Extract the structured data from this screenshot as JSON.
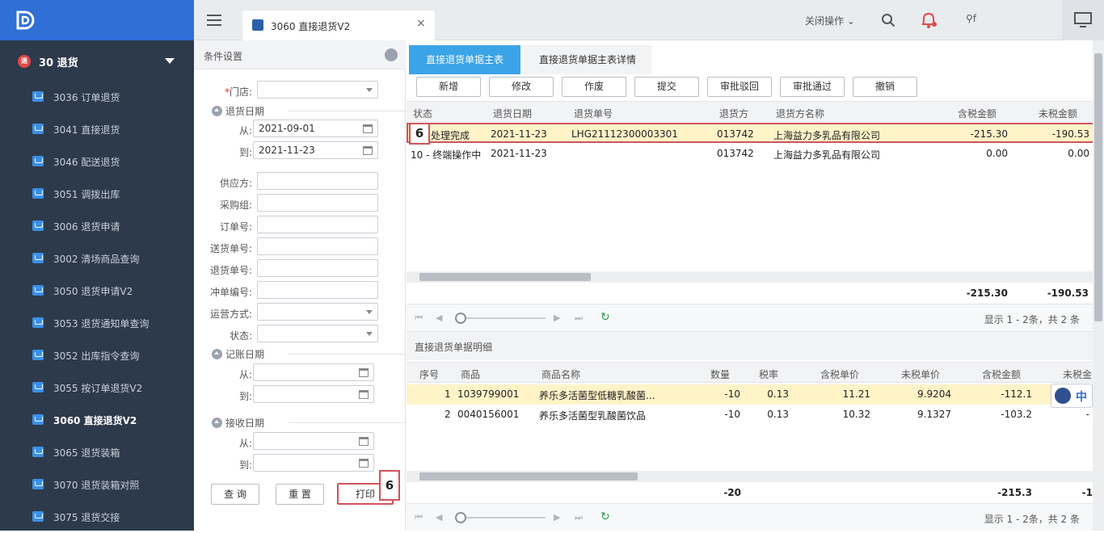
{
  "sidebar": {
    "group_badge": "退",
    "group_label": "30 退货",
    "items": [
      {
        "label": "3036 订单退货"
      },
      {
        "label": "3041 直接退货"
      },
      {
        "label": "3046 配送退货"
      },
      {
        "label": "3051 调拨出库"
      },
      {
        "label": "3006 退货申请"
      },
      {
        "label": "3002 清场商品查询"
      },
      {
        "label": "3050 退货申请V2"
      },
      {
        "label": "3053 退货通知单查询"
      },
      {
        "label": "3052 出库指令查询"
      },
      {
        "label": "3055 按订单退货V2"
      },
      {
        "label": "3060 直接退货V2"
      },
      {
        "label": "3065 退货装箱"
      },
      {
        "label": "3070 退货装箱对照"
      },
      {
        "label": "3075 退货交接"
      }
    ],
    "active_index": 10
  },
  "header": {
    "tab_title": "3060 直接退货V2",
    "tab_close": "×",
    "close_ops": "关闭操作 ⌄",
    "user_text": "⚲f"
  },
  "conditions": {
    "title": "条件设置",
    "store_label": "*门店:",
    "store_req": "*",
    "store_text": "门店:",
    "return_date": "退货日期",
    "from_label": "从:",
    "to_label": "到:",
    "return_from": "2021-09-01",
    "return_to": "2021-11-23",
    "supplier": "供应方:",
    "purchase_group": "采购组:",
    "order_no": "订单号:",
    "delivery_no": "送货单号:",
    "return_no": "退货单号:",
    "reverse_no": "冲单编号:",
    "ship_mode": "运营方式:",
    "status": "状态:",
    "book_date": "记账日期",
    "receive_date": "接收日期",
    "btn_query": "查 询",
    "btn_reset": "重 置",
    "btn_print": "打印",
    "mark": "6"
  },
  "main": {
    "tabs": [
      "直接退货单据主表",
      "直接退货单据主表详情"
    ],
    "toolbar": [
      "新增",
      "修改",
      "作废",
      "提交",
      "审批驳回",
      "审批通过",
      "撤销"
    ],
    "header_cols": [
      "状态",
      "退货日期",
      "退货单号",
      "退货方",
      "退货方名称",
      "含税金额",
      "未税金额"
    ],
    "rows": [
      {
        "status": "处理完成",
        "date": "2021-11-23",
        "no": "LHG21112300003301",
        "party": "013742",
        "name": "上海益力多乳品有限公司",
        "tax": "-215.30",
        "notax": "-190.53"
      },
      {
        "status": "10 - 终端操作中",
        "date": "2021-11-23",
        "no": "",
        "party": "013742",
        "name": "上海益力多乳品有限公司",
        "tax": "0.00",
        "notax": "0.00"
      }
    ],
    "mark": "6",
    "total_tax": "-215.30",
    "total_notax": "-190.53",
    "pager_text": "显示 1 - 2条，共 2 条"
  },
  "detail": {
    "title": "直接退货单据明细",
    "cols": [
      "序号",
      "商品",
      "商品名称",
      "数量",
      "税率",
      "含税单价",
      "未税单价",
      "含税金额",
      "未税金"
    ],
    "rows": [
      {
        "seq": "1",
        "code": "1039799001",
        "name": "养乐多活菌型低糖乳酸菌...",
        "qty": "-10",
        "rate": "0.13",
        "price": "11.21",
        "nprice": "9.9204",
        "amt": "-112.1",
        "namt": ""
      },
      {
        "seq": "2",
        "code": "0040156001",
        "name": "养乐多活菌型乳酸菌饮品",
        "qty": "-10",
        "rate": "0.13",
        "price": "10.32",
        "nprice": "9.1327",
        "amt": "-103.2",
        "namt": "-"
      }
    ],
    "total_qty": "-20",
    "total_amt": "-215.3",
    "total_namt": "-1",
    "pager_text": "显示 1 - 2条，共 2 条",
    "ime_text": "中"
  },
  "colors": {
    "sidebar": "#2d3a4b",
    "accent": "#3ba3e8",
    "highlight": "#fff3c8",
    "mark_border": "#d0535a"
  }
}
